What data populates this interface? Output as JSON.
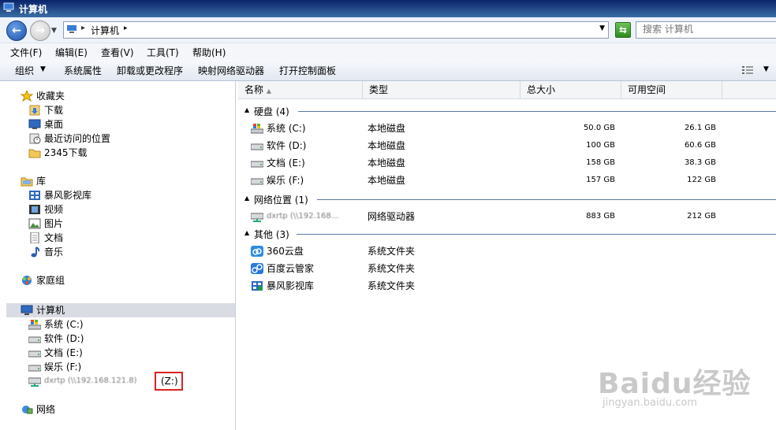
{
  "window": {
    "title": "计算机"
  },
  "address": {
    "crumb": "计算机",
    "search_placeholder": "搜索 计算机"
  },
  "menu": [
    "文件(F)",
    "编辑(E)",
    "查看(V)",
    "工具(T)",
    "帮助(H)"
  ],
  "toolbar": {
    "organize": "组织",
    "buttons": [
      "系统属性",
      "卸载或更改程序",
      "映射网络驱动器",
      "打开控制面板"
    ]
  },
  "nav": {
    "favorites": "收藏夹",
    "favorites_items": [
      "下载",
      "桌面",
      "最近访问的位置",
      "2345下载"
    ],
    "library": "库",
    "library_items": [
      "暴风影视库",
      "视频",
      "图片",
      "文档",
      "音乐"
    ],
    "homegroup": "家庭组",
    "computer": "计算机",
    "computer_items": [
      "系统 (C:)",
      "软件 (D:)",
      "文档 (E:)",
      "娱乐 (F:)"
    ],
    "net_drive_label": "dxrtp (\\\\192.168.121.8)",
    "net_drive_letter": "(Z:)",
    "network": "网络"
  },
  "columns": {
    "name": "名称",
    "type": "类型",
    "total": "总大小",
    "free": "可用空间"
  },
  "groups": {
    "hdd": {
      "label": "硬盘 (4)",
      "rows": [
        {
          "name": "系统 (C:)",
          "type": "本地磁盘",
          "total": "50.0 GB",
          "free": "26.1 GB"
        },
        {
          "name": "软件 (D:)",
          "type": "本地磁盘",
          "total": "100 GB",
          "free": "60.6 GB"
        },
        {
          "name": "文档 (E:)",
          "type": "本地磁盘",
          "total": "158 GB",
          "free": "38.3 GB"
        },
        {
          "name": "娱乐 (F:)",
          "type": "本地磁盘",
          "total": "157 GB",
          "free": "122 GB"
        }
      ]
    },
    "net": {
      "label": "网络位置 (1)",
      "rows": [
        {
          "name": "dxrtp (\\\\192.168...",
          "type": "网络驱动器",
          "total": "883 GB",
          "free": "212 GB"
        }
      ]
    },
    "other": {
      "label": "其他 (3)",
      "rows": [
        {
          "name": "360云盘",
          "type": "系统文件夹"
        },
        {
          "name": "百度云管家",
          "type": "系统文件夹"
        },
        {
          "name": "暴风影视库",
          "type": "系统文件夹"
        }
      ]
    }
  },
  "watermark": {
    "logo": "Baidu经验",
    "url": "jingyan.baidu.com"
  }
}
